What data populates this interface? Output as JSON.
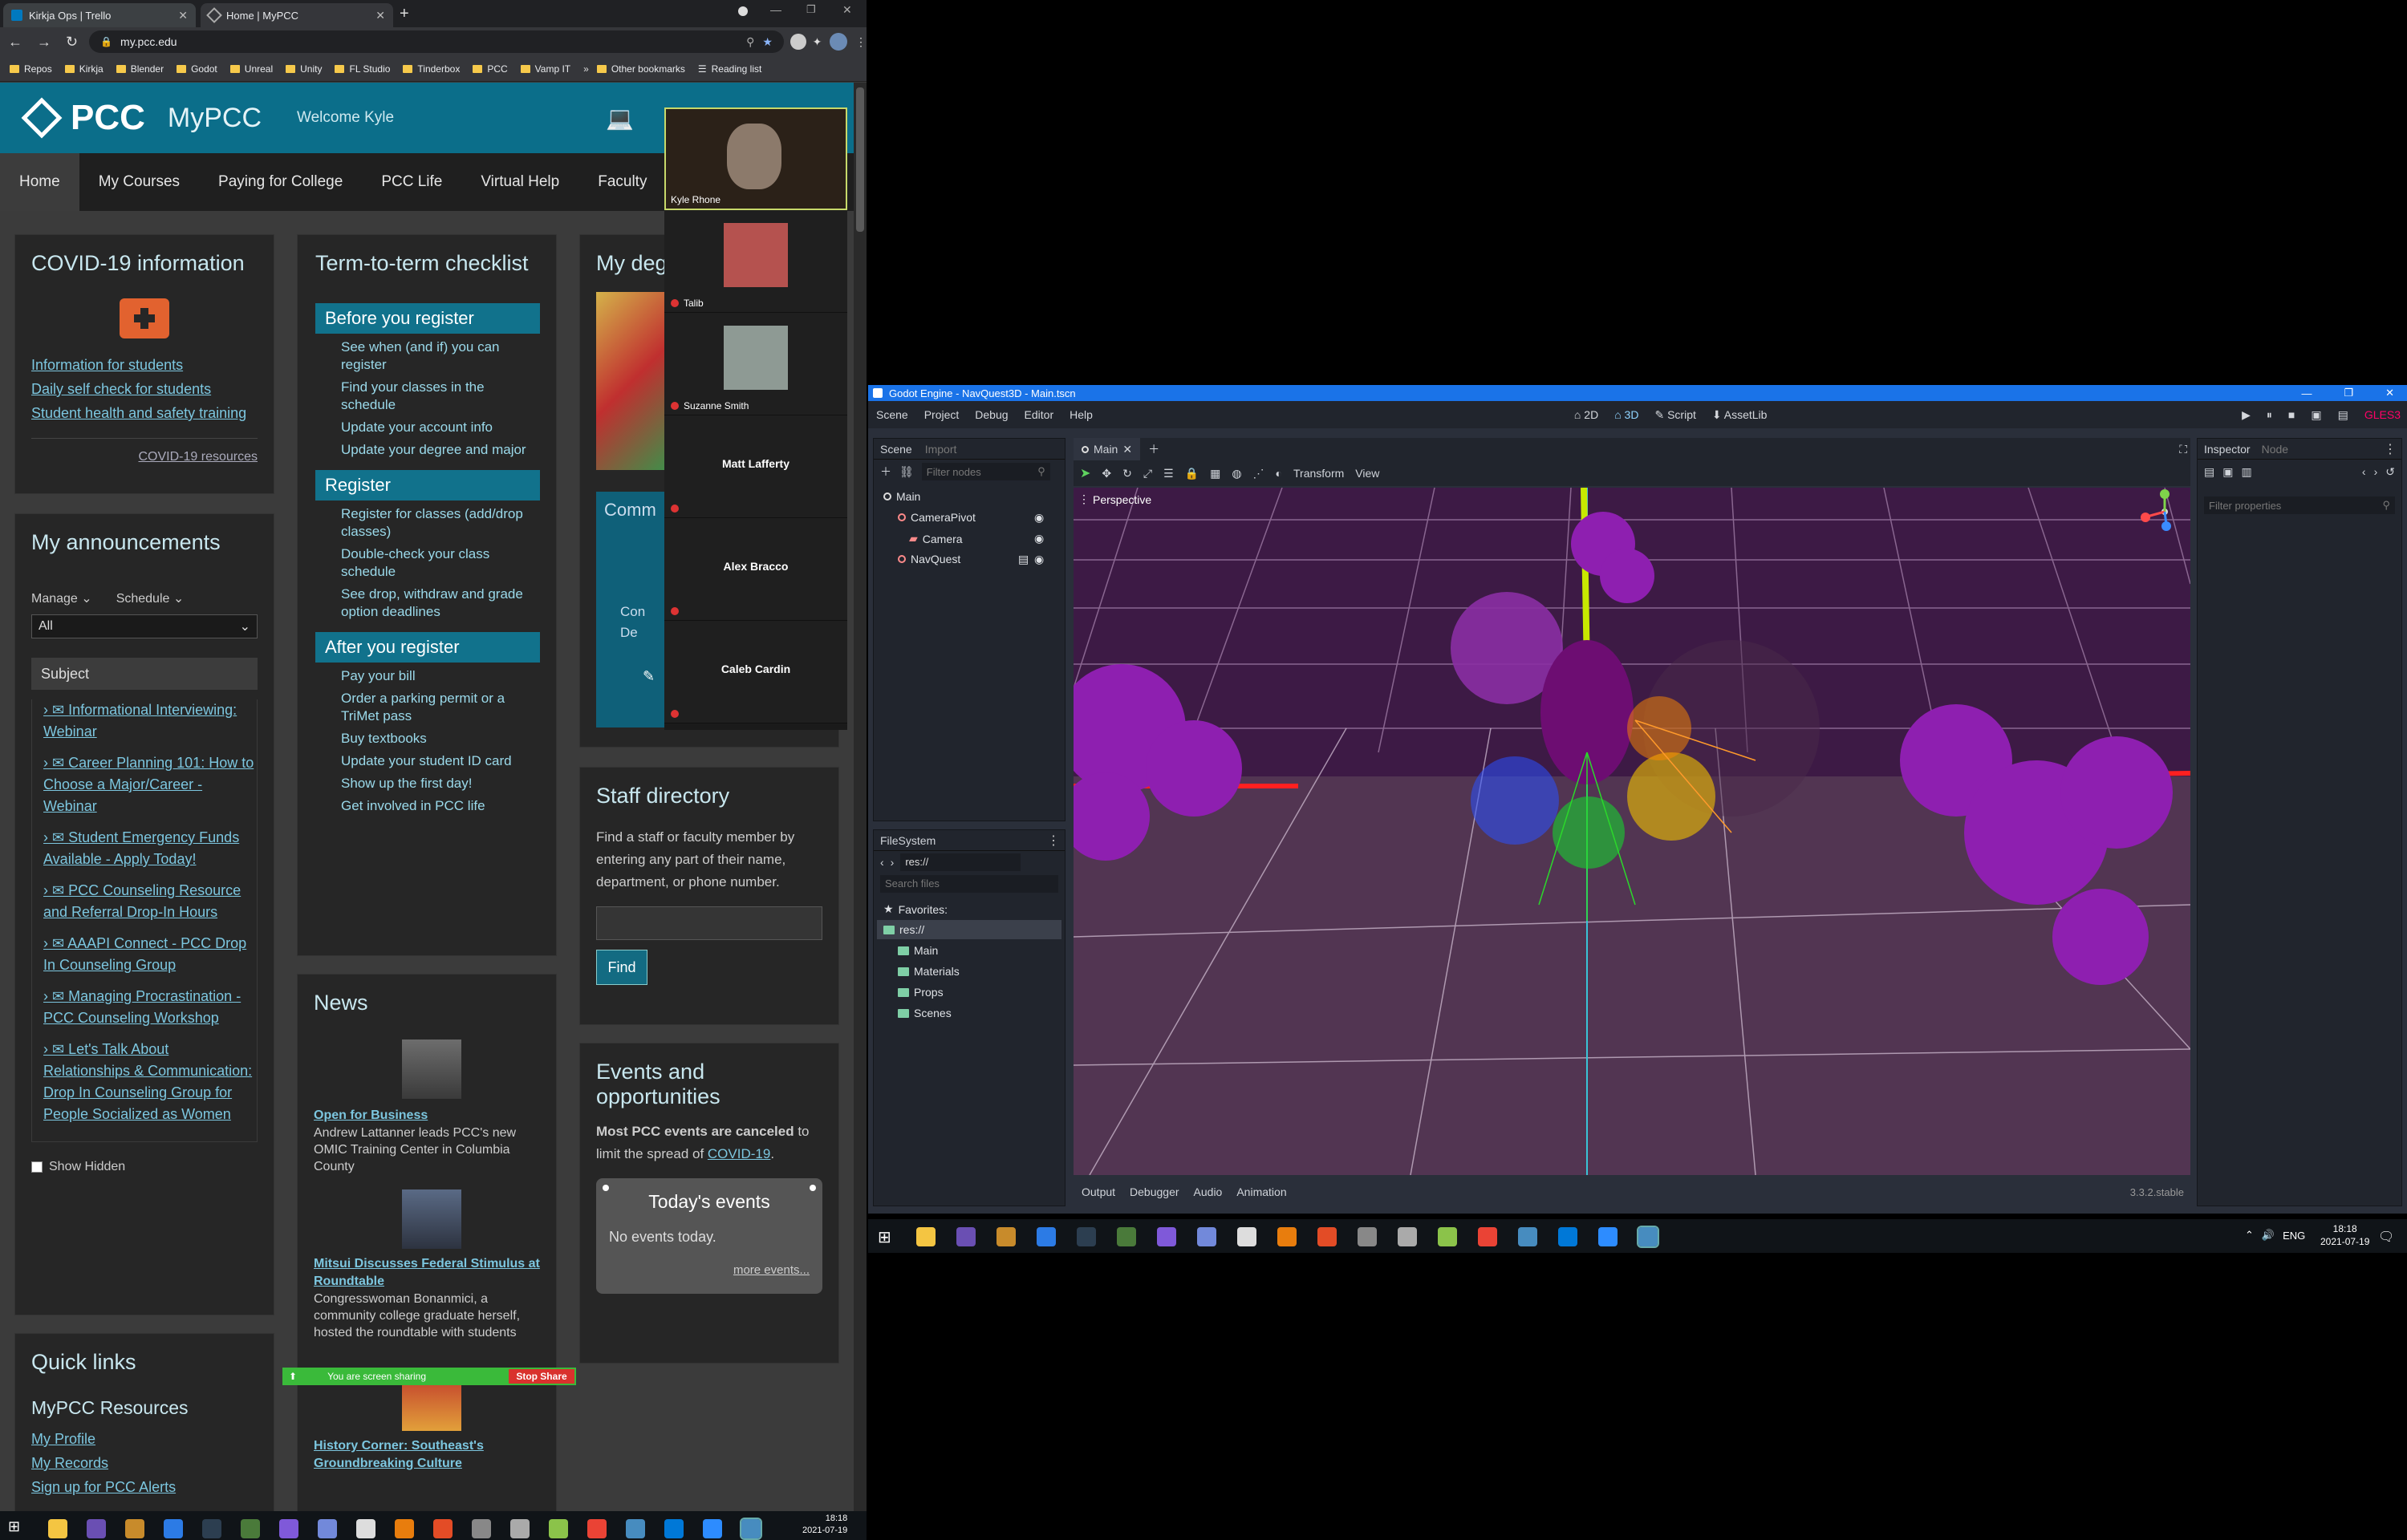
{
  "browser": {
    "tabs": [
      {
        "label": "Kirkja Ops | Trello"
      },
      {
        "label": "Home | MyPCC"
      }
    ],
    "url": "my.pcc.edu",
    "bookmarks": [
      "Repos",
      "Kirkja",
      "Blender",
      "Godot",
      "Unreal",
      "Unity",
      "FL Studio",
      "Tinderbox",
      "PCC",
      "Vamp IT"
    ],
    "other_bookmarks": "Other bookmarks",
    "reading_list": "Reading list"
  },
  "pcc": {
    "logo": "PCC",
    "app": "MyPCC",
    "welcome": "Welcome Kyle",
    "nav": [
      "Home",
      "My Courses",
      "Paying for College",
      "PCC Life",
      "Virtual Help",
      "Faculty"
    ],
    "covid": {
      "title": "COVID-19 information",
      "links": [
        "Information for students",
        "Daily self check for students",
        "Student health and safety training"
      ],
      "resources": "COVID-19 resources"
    },
    "announcements": {
      "title": "My announcements",
      "manage": "Manage",
      "schedule": "Schedule",
      "filter": "All",
      "subject": "Subject",
      "items": [
        "Informational Interviewing: Webinar",
        "Career Planning 101: How to Choose a Major/Career - Webinar",
        "Student Emergency Funds Available - Apply Today!",
        "PCC Counseling Resource and Referral Drop-In Hours",
        "AAAPI Connect - PCC Drop In Counseling Group",
        "Managing Procrastination - PCC Counseling Workshop",
        "Let's Talk About Relationships & Communication: Drop In Counseling Group for People Socialized as Women"
      ],
      "show_hidden": "Show Hidden"
    },
    "quick": {
      "title": "Quick links",
      "sub": "MyPCC Resources",
      "links": [
        "My Profile",
        "My Records",
        "Sign up for PCC Alerts"
      ]
    },
    "checklist": {
      "title": "Term-to-term checklist",
      "sections": [
        {
          "head": "Before you register",
          "items": [
            "See when (and if) you can register",
            "Find your classes in the schedule",
            "Update your account info",
            "Update your degree and major"
          ]
        },
        {
          "head": "Register",
          "items": [
            "Register for classes (add/drop classes)",
            "Double-check your class schedule",
            "See drop, withdraw and grade option deadlines"
          ]
        },
        {
          "head": "After you register",
          "items": [
            "Pay your bill",
            "Order a parking permit or a TriMet pass",
            "Buy textbooks",
            "Update your student ID card",
            "Show up the first day!",
            "Get involved in PCC life"
          ]
        }
      ]
    },
    "news": {
      "title": "News",
      "items": [
        {
          "title": "Open for Business",
          "body": "Andrew Lattanner leads PCC's new OMIC Training Center in Columbia County"
        },
        {
          "title": "Mitsui Discusses Federal Stimulus at Roundtable",
          "body": "Congresswoman Bonanmici, a community college graduate herself, hosted the roundtable with students"
        },
        {
          "title": "History Corner: Southeast's Groundbreaking Culture",
          "body": ""
        }
      ]
    },
    "degree": {
      "title": "My deg",
      "comm": "Comm",
      "con": "Con",
      "de": "De"
    },
    "staff": {
      "title": "Staff directory",
      "desc": "Find a staff or faculty member by entering any part of their name, department, or phone number.",
      "find": "Find"
    },
    "events": {
      "title": "Events and opportunities",
      "notice_bold": "Most PCC events are canceled",
      "notice_rest": " to limit the spread of ",
      "covid": "COVID-19",
      "period": ".",
      "today": "Today's events",
      "none": "No events today.",
      "more": "more events..."
    }
  },
  "zoom": {
    "participants": [
      "Kyle Rhone",
      "Talib",
      "Suzanne Smith",
      "Matt Lafferty",
      "Alex Bracco",
      "Caleb Cardin"
    ]
  },
  "share": {
    "text": "You are screen sharing",
    "stop": "Stop Share"
  },
  "godot": {
    "title": "Godot Engine - NavQuest3D - Main.tscn",
    "menu": [
      "Scene",
      "Project",
      "Debug",
      "Editor",
      "Help"
    ],
    "modes": [
      "2D",
      "3D",
      "Script",
      "AssetLib"
    ],
    "renderer": "GLES3",
    "scene_tabs": [
      "Scene",
      "Import"
    ],
    "filter_nodes": "Filter nodes",
    "tree": [
      "Main",
      "CameraPivot",
      "Camera",
      "NavQuest"
    ],
    "filesystem": "FileSystem",
    "path": "res://",
    "search_files": "Search files",
    "favorites": "Favorites:",
    "folders": [
      "res://",
      "Main",
      "Materials",
      "Props",
      "Scenes"
    ],
    "editor_tab": "Main",
    "toolbar": [
      "Transform",
      "View"
    ],
    "perspective": "Perspective",
    "inspector_tabs": [
      "Inspector",
      "Node"
    ],
    "filter_props": "Filter properties",
    "bottom": [
      "Output",
      "Debugger",
      "Audio",
      "Animation"
    ],
    "version": "3.3.2.stable"
  },
  "taskbar_right": {
    "lang": "ENG",
    "time": "18:18",
    "date": "2021-07-19"
  },
  "taskbar_left": {
    "time": "18:18",
    "date": "2021-07-19"
  }
}
